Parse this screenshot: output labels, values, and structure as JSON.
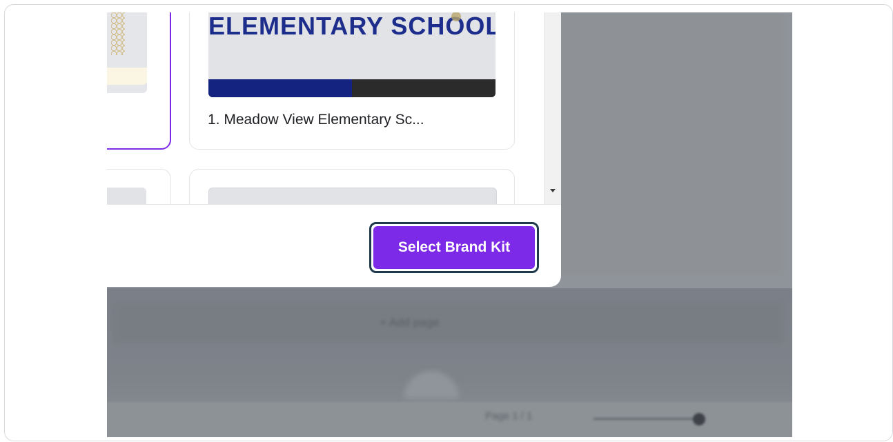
{
  "brand_kits": [
    {
      "thumbnail_title": "ELEMENTARY SCHOOL",
      "name": "1. Meadow View Elementary Sc..."
    }
  ],
  "footer": {
    "select_label": "Select Brand Kit"
  },
  "background": {
    "add_page_label": "+ Add page",
    "page_indicator": "Page 1 / 1"
  },
  "colors": {
    "accent": "#7d2ae8",
    "navy": "#13237f",
    "focus_ring": "#1e3a4c"
  }
}
